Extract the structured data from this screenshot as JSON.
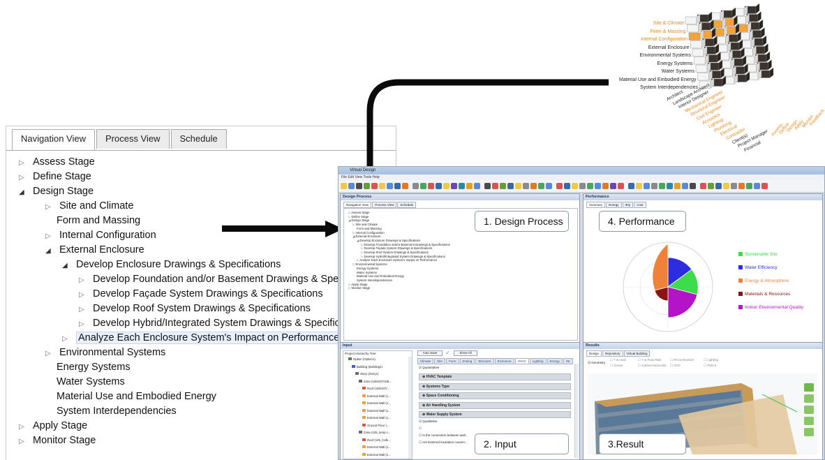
{
  "nav": {
    "tabs": [
      "Navigation View",
      "Process View",
      "Schedule"
    ],
    "tree": [
      {
        "label": "Assess Stage",
        "indent": 0,
        "arrow": "closed"
      },
      {
        "label": "Define Stage",
        "indent": 0,
        "arrow": "closed"
      },
      {
        "label": "Design Stage",
        "indent": 0,
        "arrow": "open",
        "selected": true
      },
      {
        "label": "Site and Climate",
        "indent": 1,
        "arrow": "closed"
      },
      {
        "label": "Form and Massing",
        "indent": 1,
        "arrow": "none"
      },
      {
        "label": "Internal Configuration",
        "indent": 1,
        "arrow": "closed"
      },
      {
        "label": "External Enclosure",
        "indent": 1,
        "arrow": "open"
      },
      {
        "label": "Develop Enclosure Drawings & Specifications",
        "indent": 2,
        "arrow": "open"
      },
      {
        "label": "Develop Foundation and/or Basement Drawings & Specifications",
        "indent": 3,
        "arrow": "closed"
      },
      {
        "label": "Develop Façade System Drawings & Specifications",
        "indent": 3,
        "arrow": "closed"
      },
      {
        "label": "Develop Roof System Drawings & Specifications",
        "indent": 3,
        "arrow": "closed"
      },
      {
        "label": "Develop Hybrid/Integrated System Drawings & Specifications",
        "indent": 3,
        "arrow": "closed"
      },
      {
        "label": "Analyze Each Enclosure System's Impact on Performance",
        "indent": 2,
        "arrow": "closed",
        "selected": true
      },
      {
        "label": "Environmental Systems",
        "indent": 1,
        "arrow": "closed"
      },
      {
        "label": "Energy Systems",
        "indent": 1,
        "arrow": "none"
      },
      {
        "label": "Water Systems",
        "indent": 1,
        "arrow": "none"
      },
      {
        "label": "Material Use and Embodied Energy",
        "indent": 1,
        "arrow": "none"
      },
      {
        "label": "System Interdependencies",
        "indent": 1,
        "arrow": "none"
      },
      {
        "label": "Apply Stage",
        "indent": 0,
        "arrow": "closed"
      },
      {
        "label": "Monitor Stage",
        "indent": 0,
        "arrow": "closed"
      }
    ]
  },
  "matrix": {
    "row_labels": [
      {
        "text": "Site & Climate",
        "highlight": true
      },
      {
        "text": "Form & Massing",
        "highlight": true
      },
      {
        "text": "Internal Configuration",
        "highlight": true
      },
      {
        "text": "External Enclosure",
        "highlight": false
      },
      {
        "text": "Environmental Systems",
        "highlight": false
      },
      {
        "text": "Energy Systems",
        "highlight": false
      },
      {
        "text": "Water Systems",
        "highlight": false
      },
      {
        "text": "Material Use and Embodied Energy",
        "highlight": false
      },
      {
        "text": "System Interdependencies",
        "highlight": false
      }
    ],
    "role_labels": [
      {
        "text": "Architect",
        "highlight": false
      },
      {
        "text": "Landscape Architect",
        "highlight": false
      },
      {
        "text": "Interior Designer",
        "highlight": false
      },
      {
        "text": "Mechanical Engineer",
        "highlight": true
      },
      {
        "text": "Structural Engineer",
        "highlight": true
      },
      {
        "text": "Civil Engineer",
        "highlight": true
      },
      {
        "text": "Acoustics",
        "highlight": true
      },
      {
        "text": "Lighting",
        "highlight": true
      },
      {
        "text": "Plumbing",
        "highlight": true
      },
      {
        "text": "Electrical",
        "highlight": true
      },
      {
        "text": "Contractor",
        "highlight": true
      },
      {
        "text": "Client(s)",
        "highlight": false
      },
      {
        "text": "Project Manager",
        "highlight": false
      },
      {
        "text": "Financial",
        "highlight": false
      }
    ],
    "column_labels": [
      "Assess",
      "Define",
      "Design",
      "Apply",
      "Monitor",
      "Feedback"
    ]
  },
  "app": {
    "title": "Virtual Design",
    "menu": "File  Edit  View  Tools  Help",
    "design_process": {
      "header": "Design Process",
      "tabs": [
        "Navigation View",
        "Process View",
        "Schedule"
      ],
      "tree": [
        "Assess Stage",
        "Define Stage",
        "Design Stage",
        "Site and Climate",
        "Form and Massing",
        "Internal Configuration",
        "External Enclosure",
        "Develop Enclosure Drawings & Specifications",
        "Develop Foundation and/or Basement Drawings & Specifications",
        "Develop Façade System Drawings & Specifications",
        "Develop Roof System Drawings & Specifications",
        "Develop Hybrid/Integrated System Drawings & Specifications",
        "Analyze Each Enclosure System's Impact on Performance",
        "Environmental Systems",
        "Energy Systems",
        "Water Systems",
        "Material Use and Embodied Energy",
        "System Interdependencies",
        "Apply Stage",
        "Monitor Stage"
      ],
      "callout": "1. Design Process"
    },
    "performance": {
      "header": "Performance",
      "tabs": [
        "Summary",
        "Energy",
        "IEQ",
        "Cost"
      ],
      "callout": "4. Performance",
      "legend": [
        {
          "label": "Sustainable Site",
          "color": "#3ddc4a"
        },
        {
          "label": "Water Efficiency",
          "color": "#2d2de0"
        },
        {
          "label": "Energy & Atmosphere",
          "color": "#f0813a"
        },
        {
          "label": "Materials & Resources",
          "color": "#8a1414"
        },
        {
          "label": "Indoor Environmental Quality",
          "color": "#b314c8"
        }
      ]
    },
    "input": {
      "header": "Input",
      "hierarchy_title": "Project Hierarchy Tree",
      "hierarchy": [
        "Option (Option1)",
        "Building (Building1)",
        "Story (Story1)",
        "Zone (106/107/108...",
        "Roof (106/107/...",
        "External Wall (1...",
        "External Wall (1...",
        "External Wall (1...",
        "External Wall (1...",
        "Ground Floor (...",
        "Zone (105_temp c...",
        "Roof (105_Cafe...",
        "External Wall (1...",
        "External Wall (1..."
      ],
      "auto_save": "Auto Save",
      "show_all": "Show All",
      "tabs": [
        "Climate",
        "Site",
        "Form",
        "Zoning",
        "Structure",
        "Enclosure",
        "HVAC",
        "Lighting",
        "Energy",
        "Str"
      ],
      "quantitative": "Quantitative",
      "sections": [
        "HVAC Template",
        "Systems Type",
        "Space Conditioning",
        "Air Handling System",
        "Water Supply System"
      ],
      "qualitative": "Qualitative",
      "questions": [
        "Is the connection between wall...",
        "Are External insulation coverin..."
      ],
      "callout": "2. Input"
    },
    "results": {
      "header": "Results",
      "tabs": [
        "Design",
        "Repository",
        "Virtual Building"
      ],
      "filters": [
        "Geometry",
        "T & Heat",
        "Y & Flow Rate",
        "RH & Moisture",
        "Lighting",
        "Ozone",
        "Carbon Monoxide",
        "VOC",
        "PM2.5"
      ],
      "callout": "3.Result"
    }
  }
}
